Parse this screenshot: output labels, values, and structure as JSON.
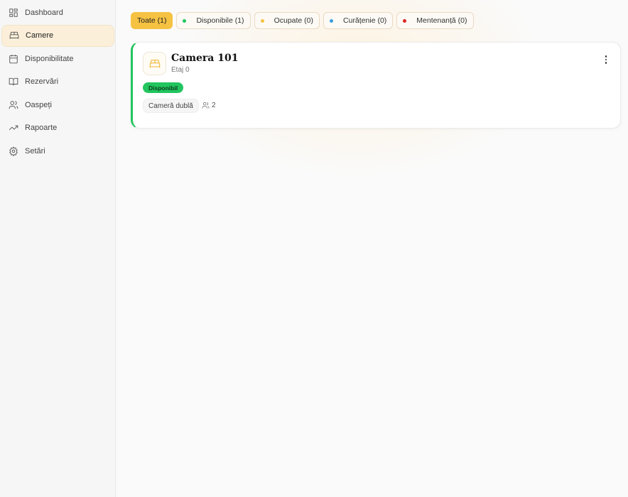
{
  "sidebar": {
    "items": [
      {
        "label": "Dashboard",
        "icon": "dashboard-icon"
      },
      {
        "label": "Camere",
        "icon": "bed-icon",
        "active": true
      },
      {
        "label": "Disponibilitate",
        "icon": "calendar-icon"
      },
      {
        "label": "Rezervări",
        "icon": "book-icon"
      },
      {
        "label": "Oaspeți",
        "icon": "users-icon"
      },
      {
        "label": "Rapoarte",
        "icon": "trending-up-icon"
      },
      {
        "label": "Setări",
        "icon": "gear-icon"
      }
    ]
  },
  "filters": [
    {
      "label": "Toate (1)",
      "active": true
    },
    {
      "label": "Disponibile (1)",
      "color": "#22c55e"
    },
    {
      "label": "Ocupate (0)",
      "color": "#f5c242"
    },
    {
      "label": "Curățenie (0)",
      "color": "#3b9fe0"
    },
    {
      "label": "Mentenanță (0)",
      "color": "#dc2626"
    }
  ],
  "room": {
    "name": "Camera 101",
    "floor": "Etaj 0",
    "status": "Disponibil",
    "status_color": "#22c55e",
    "type": "Cameră dublă",
    "capacity": "2"
  }
}
